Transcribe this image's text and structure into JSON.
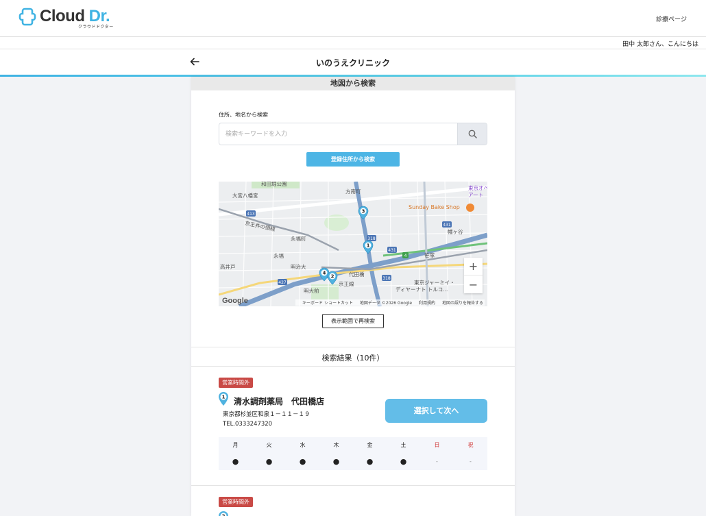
{
  "header": {
    "logo_text_main": "Cloud",
    "logo_text_accent": "Dr.",
    "logo_sub": "クラウドドクター",
    "nav_link": "診療ページ",
    "greeting": "田中 太郎さん、こんにちは"
  },
  "clinic": {
    "title": "いのうえクリニック"
  },
  "map_search": {
    "section_title": "地図から検索",
    "field_label": "住所、地名から検索",
    "placeholder": "検索キーワードを入力",
    "registered_button": "登録住所から検索",
    "redo_button": "表示範囲で再検索",
    "attribution": [
      "キーボード ショートカット",
      "地図データ ©2026 Google",
      "利用規約",
      "地図の誤りを報告する"
    ],
    "map_labels": [
      "和田堀公園",
      "大宮八幡宮",
      "方南町",
      "東京オペラシティ",
      "アート",
      "Sunday Bake Shop",
      "幡ヶ谷",
      "京王井の頭線",
      "永福町",
      "永福",
      "明治大",
      "笹塚",
      "代田橋",
      "京王線",
      "高井戸",
      "明大前",
      "東京ジャーミイ・",
      "ディヤーナト トルコ...",
      "幡ヶ谷"
    ],
    "map_pins": [
      "1",
      "2",
      "3",
      "4"
    ],
    "road_shields": [
      "413",
      "318",
      "431",
      "427",
      "431",
      "318",
      "4"
    ],
    "zoom_in": "+",
    "zoom_out": "−",
    "google_text": "Google"
  },
  "results": {
    "title": "検索結果（10件）",
    "items": [
      {
        "badge": "営業時間外",
        "pin": "1",
        "name": "清水調剤薬局　代田橋店",
        "address": "東京都杉並区和泉１－１１－１９",
        "tel": "TEL.0333247320",
        "select_button": "選択して次へ",
        "days": [
          "月",
          "火",
          "水",
          "木",
          "金",
          "土",
          "日",
          "祝"
        ],
        "status": [
          "●",
          "●",
          "●",
          "●",
          "●",
          "●",
          "-",
          "-"
        ]
      },
      {
        "badge": "営業時間外",
        "pin": "2"
      }
    ]
  },
  "colors": {
    "accent": "#3fb3e3",
    "button_blue": "#4db5e5",
    "badge_red": "#c94a46",
    "holiday_red": "#d23c3c"
  }
}
